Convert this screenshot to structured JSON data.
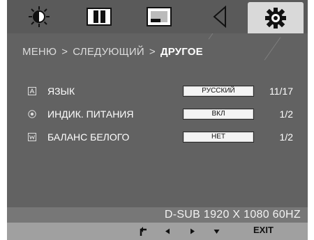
{
  "tabs": [
    {
      "icon": "brightness-icon",
      "active": false
    },
    {
      "icon": "picture-columns-icon",
      "active": false
    },
    {
      "icon": "screen-position-icon",
      "active": false
    },
    {
      "icon": "sound-icon",
      "active": false
    },
    {
      "icon": "settings-gear-icon",
      "active": true
    }
  ],
  "breadcrumb": {
    "level1": "МЕНЮ",
    "separator": ">",
    "level2": "СЛЕДУЮЩИЙ",
    "level3": "ДРУГОЕ"
  },
  "settings": [
    {
      "icon": "language-icon",
      "label": "ЯЗЫК",
      "value": "РУССКИЙ",
      "count": "11/17"
    },
    {
      "icon": "power-indicator-icon",
      "label": "ИНДИК. ПИТАНИЯ",
      "value": "ВКЛ",
      "count": "1/2"
    },
    {
      "icon": "white-balance-icon",
      "label": "БАЛАНС БЕЛОГО",
      "value": "НЕТ",
      "count": "1/2"
    }
  ],
  "status": {
    "signal": "D-SUB 1920 X 1080 60HZ"
  },
  "nav": {
    "exit_label": "EXIT"
  },
  "colors": {
    "panel": "#626262",
    "tab_active": "#d9d9d9",
    "status_bar": "#777777",
    "nav_bar": "#a0a0a0"
  }
}
